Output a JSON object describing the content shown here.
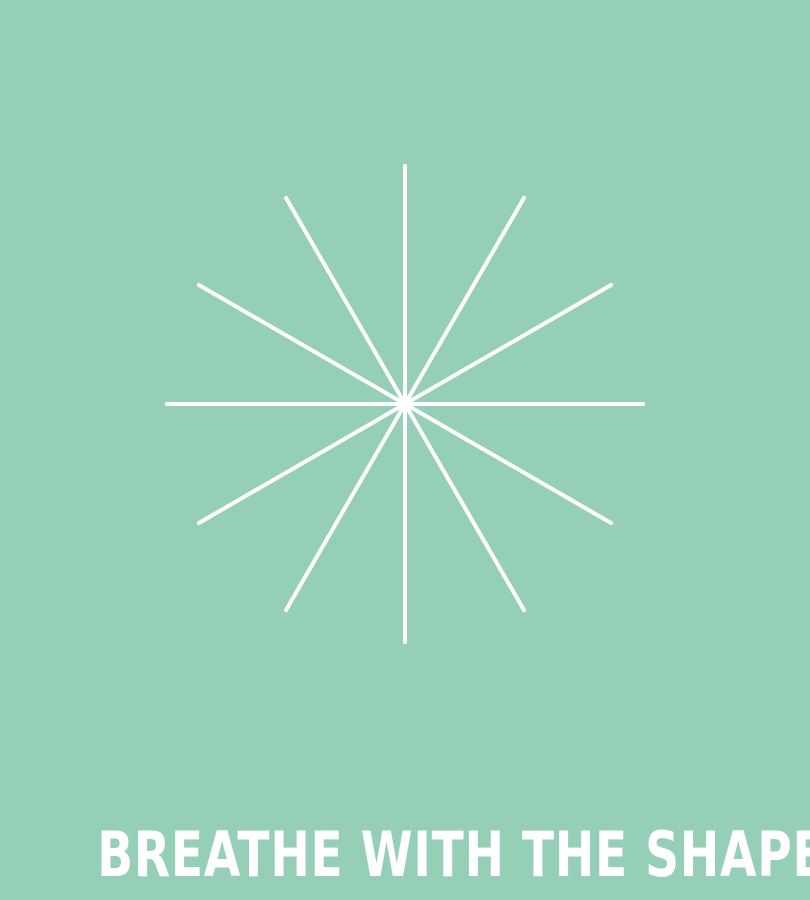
{
  "colors": {
    "background": "#96CFB8",
    "shape": "#FFFFFF",
    "text": "#FFFFFF"
  },
  "shape": {
    "icon": "twelve-ray-starburst-icon",
    "ray_count": 12
  },
  "caption": {
    "text": "BREATHE WITH THE SHAPE"
  }
}
